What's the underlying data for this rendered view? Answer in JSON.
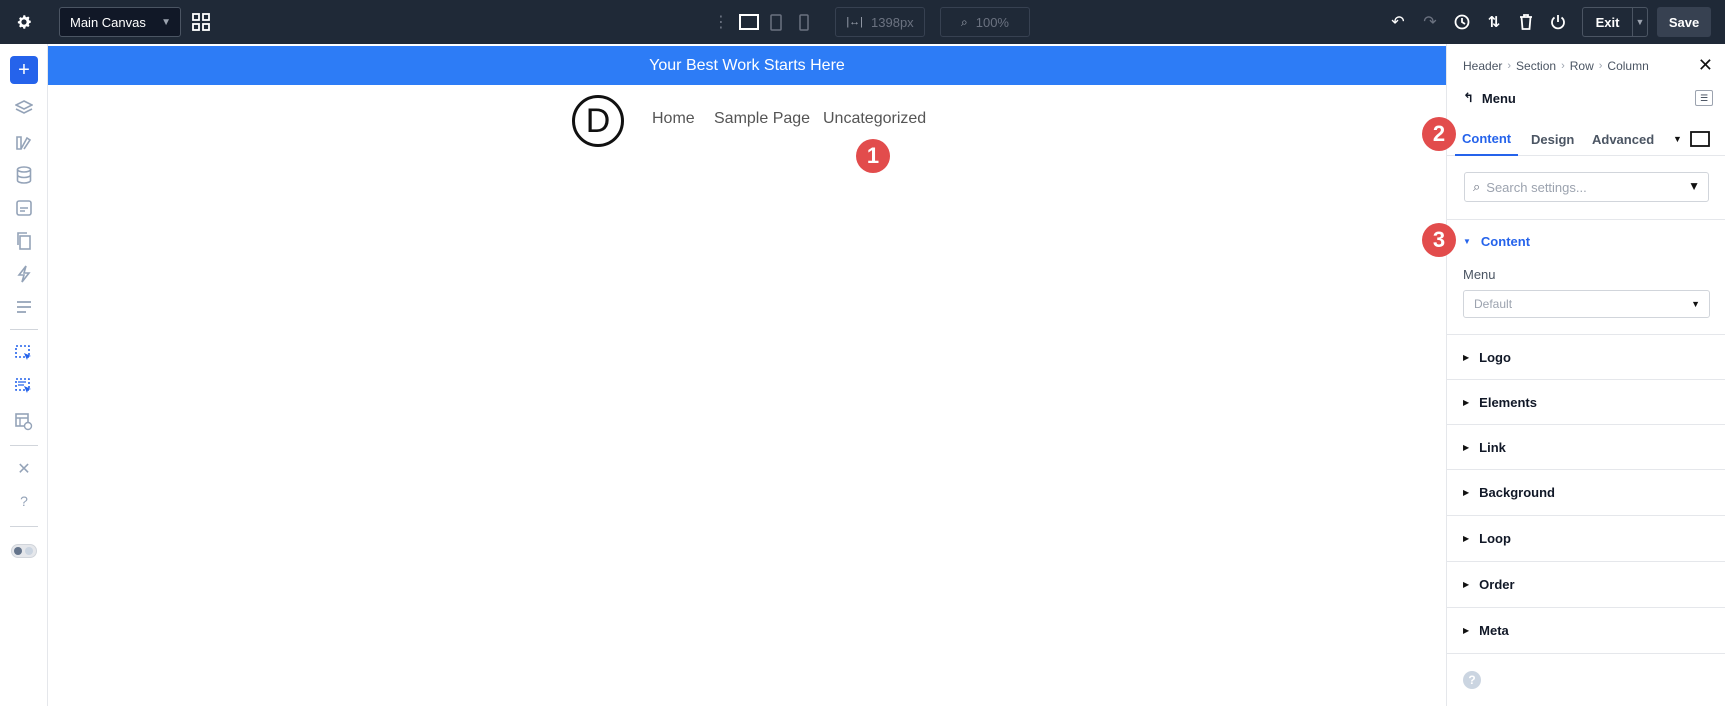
{
  "toolbar": {
    "canvas_select": "Main Canvas",
    "width_value": "1398px",
    "zoom_value": "100%",
    "exit_label": "Exit",
    "save_label": "Save"
  },
  "leftbar": {
    "add_label": "+",
    "help_label": "?"
  },
  "page": {
    "banner": "Your Best Work Starts Here",
    "logo_letter": "D",
    "nav_links": [
      "Home",
      "Sample Page",
      "Uncategorized"
    ]
  },
  "badges": [
    "1",
    "2",
    "3"
  ],
  "panel": {
    "breadcrumb": [
      "Header",
      "Section",
      "Row",
      "Column"
    ],
    "module_title": "Menu",
    "tabs": [
      "Content",
      "Design",
      "Advanced"
    ],
    "search_placeholder": "Search settings...",
    "groups": [
      "Content",
      "Logo",
      "Elements",
      "Link",
      "Background",
      "Loop",
      "Order",
      "Meta"
    ],
    "menu_field_label": "Menu",
    "menu_field_value": "Default",
    "help_label": "?"
  },
  "colors": {
    "accent": "#2563eb",
    "banner": "#2d7cf6",
    "topbar": "#1f2937",
    "badge": "#e24c4c"
  }
}
